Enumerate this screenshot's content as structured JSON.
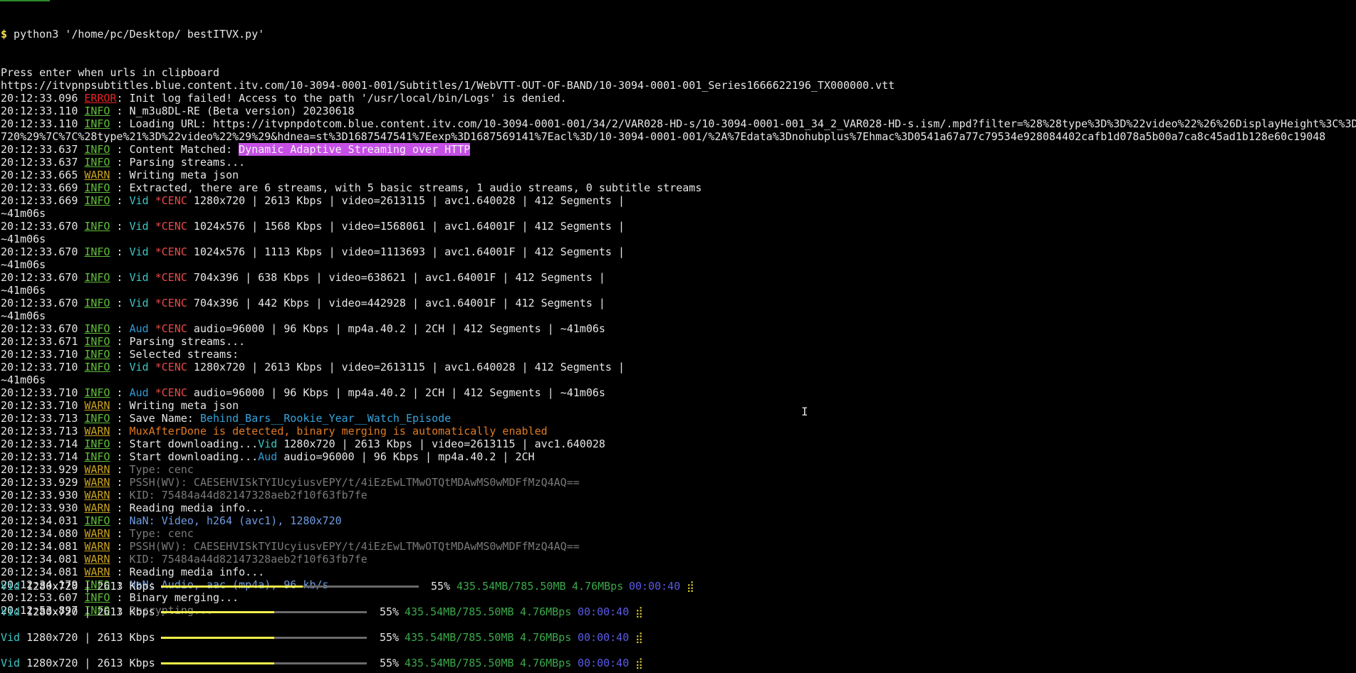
{
  "prompt": {
    "dollar": "$",
    "command": " python3 '/home/pc/Desktop/ bestITVX.py'"
  },
  "lines": [
    [
      {
        "t": "Press enter when urls in clipboard",
        "c": "plain"
      }
    ],
    [
      {
        "t": "https://itvpnpsubtitles.blue.content.itv.com/10-3094-0001-001/Subtitles/1/WebVTT-OUT-OF-BAND/10-3094-0001-001_Series1666622196_TX000000.vtt",
        "c": "plain"
      }
    ],
    [
      {
        "t": "20:12:33.096 ",
        "c": "ts"
      },
      {
        "t": "ERROR",
        "c": "error"
      },
      {
        "t": ": Init log failed! Access to the path '/usr/local/bin/Logs' is denied.",
        "c": "plain"
      }
    ],
    [
      {
        "t": "20:12:33.110 ",
        "c": "ts"
      },
      {
        "t": "INFO",
        "c": "info"
      },
      {
        "t": " : N_m3u8DL-RE (Beta version) 20230618",
        "c": "plain"
      }
    ],
    [
      {
        "t": "20:12:33.110 ",
        "c": "ts"
      },
      {
        "t": "INFO",
        "c": "info"
      },
      {
        "t": " : Loading URL: https://itvpnpdotcom.blue.content.itv.com/10-3094-0001-001/34/2/VAR028-HD-s/10-3094-0001-001_34_2_VAR028-HD-s.ism/.mpd?filter=%28%28type%3D%3D%22video%22%26%26DisplayHeight%3C%3D",
        "c": "plain"
      }
    ],
    [
      {
        "t": "720%29%7C%7C%28type%21%3D%22video%22%29%29&hdnea=st%3D1687547541%7Eexp%3D1687569141%7Eacl%3D/10-3094-0001-001/%2A%7Edata%3Dnohubplus%7Ehmac%3D0541a67a77c79534e928084402cafb1d078a5b00a7ca8c45ad1b128e60c19048",
        "c": "plain"
      }
    ],
    [
      {
        "t": "20:12:33.637 ",
        "c": "ts"
      },
      {
        "t": "INFO",
        "c": "info"
      },
      {
        "t": " : Content Matched: ",
        "c": "plain"
      },
      {
        "t": "Dynamic Adaptive Streaming over HTTP",
        "c": "highlight"
      }
    ],
    [
      {
        "t": "20:12:33.637 ",
        "c": "ts"
      },
      {
        "t": "INFO",
        "c": "info"
      },
      {
        "t": " : Parsing streams...",
        "c": "plain"
      }
    ],
    [
      {
        "t": "20:12:33.665 ",
        "c": "ts"
      },
      {
        "t": "WARN",
        "c": "warn"
      },
      {
        "t": " : Writing meta json",
        "c": "plain"
      }
    ],
    [
      {
        "t": "20:12:33.669 ",
        "c": "ts"
      },
      {
        "t": "INFO",
        "c": "info"
      },
      {
        "t": " : Extracted, there are 6 streams, with 5 basic streams, 1 audio streams, 0 subtitle streams",
        "c": "plain"
      }
    ],
    [
      {
        "t": "20:12:33.669 ",
        "c": "ts"
      },
      {
        "t": "INFO",
        "c": "info"
      },
      {
        "t": " : ",
        "c": "plain"
      },
      {
        "t": "Vid",
        "c": "vid"
      },
      {
        "t": " ",
        "c": "plain"
      },
      {
        "t": "*CENC",
        "c": "cenc"
      },
      {
        "t": " 1280x720 | 2613 Kbps | video=2613115 | avc1.640028 | 412 Segments |",
        "c": "plain"
      }
    ],
    [
      {
        "t": "~41m06s",
        "c": "plain"
      }
    ],
    [
      {
        "t": "20:12:33.670 ",
        "c": "ts"
      },
      {
        "t": "INFO",
        "c": "info"
      },
      {
        "t": " : ",
        "c": "plain"
      },
      {
        "t": "Vid",
        "c": "vid"
      },
      {
        "t": " ",
        "c": "plain"
      },
      {
        "t": "*CENC",
        "c": "cenc"
      },
      {
        "t": " 1024x576 | 1568 Kbps | video=1568061 | avc1.64001F | 412 Segments |",
        "c": "plain"
      }
    ],
    [
      {
        "t": "~41m06s",
        "c": "plain"
      }
    ],
    [
      {
        "t": "20:12:33.670 ",
        "c": "ts"
      },
      {
        "t": "INFO",
        "c": "info"
      },
      {
        "t": " : ",
        "c": "plain"
      },
      {
        "t": "Vid",
        "c": "vid"
      },
      {
        "t": " ",
        "c": "plain"
      },
      {
        "t": "*CENC",
        "c": "cenc"
      },
      {
        "t": " 1024x576 | 1113 Kbps | video=1113693 | avc1.64001F | 412 Segments |",
        "c": "plain"
      }
    ],
    [
      {
        "t": "~41m06s",
        "c": "plain"
      }
    ],
    [
      {
        "t": "20:12:33.670 ",
        "c": "ts"
      },
      {
        "t": "INFO",
        "c": "info"
      },
      {
        "t": " : ",
        "c": "plain"
      },
      {
        "t": "Vid",
        "c": "vid"
      },
      {
        "t": " ",
        "c": "plain"
      },
      {
        "t": "*CENC",
        "c": "cenc"
      },
      {
        "t": " 704x396 | 638 Kbps | video=638621 | avc1.64001F | 412 Segments |",
        "c": "plain"
      }
    ],
    [
      {
        "t": "~41m06s",
        "c": "plain"
      }
    ],
    [
      {
        "t": "20:12:33.670 ",
        "c": "ts"
      },
      {
        "t": "INFO",
        "c": "info"
      },
      {
        "t": " : ",
        "c": "plain"
      },
      {
        "t": "Vid",
        "c": "vid"
      },
      {
        "t": " ",
        "c": "plain"
      },
      {
        "t": "*CENC",
        "c": "cenc"
      },
      {
        "t": " 704x396 | 442 Kbps | video=442928 | avc1.64001F | 412 Segments |",
        "c": "plain"
      }
    ],
    [
      {
        "t": "~41m06s",
        "c": "plain"
      }
    ],
    [
      {
        "t": "20:12:33.670 ",
        "c": "ts"
      },
      {
        "t": "INFO",
        "c": "info"
      },
      {
        "t": " : ",
        "c": "plain"
      },
      {
        "t": "Aud",
        "c": "aud"
      },
      {
        "t": " ",
        "c": "plain"
      },
      {
        "t": "*CENC",
        "c": "cenc"
      },
      {
        "t": " audio=96000 | 96 Kbps | mp4a.40.2 | 2CH | 412 Segments | ~41m06s",
        "c": "plain"
      }
    ],
    [
      {
        "t": "20:12:33.671 ",
        "c": "ts"
      },
      {
        "t": "INFO",
        "c": "info"
      },
      {
        "t": " : Parsing streams...",
        "c": "plain"
      }
    ],
    [
      {
        "t": "20:12:33.710 ",
        "c": "ts"
      },
      {
        "t": "INFO",
        "c": "info"
      },
      {
        "t": " : Selected streams:",
        "c": "plain"
      }
    ],
    [
      {
        "t": "20:12:33.710 ",
        "c": "ts"
      },
      {
        "t": "INFO",
        "c": "info"
      },
      {
        "t": " : ",
        "c": "plain"
      },
      {
        "t": "Vid",
        "c": "vid"
      },
      {
        "t": " ",
        "c": "plain"
      },
      {
        "t": "*CENC",
        "c": "cenc"
      },
      {
        "t": " 1280x720 | 2613 Kbps | video=2613115 | avc1.640028 | 412 Segments |",
        "c": "plain"
      }
    ],
    [
      {
        "t": "~41m06s",
        "c": "plain"
      }
    ],
    [
      {
        "t": "20:12:33.710 ",
        "c": "ts"
      },
      {
        "t": "INFO",
        "c": "info"
      },
      {
        "t": " : ",
        "c": "plain"
      },
      {
        "t": "Aud",
        "c": "aud"
      },
      {
        "t": " ",
        "c": "plain"
      },
      {
        "t": "*CENC",
        "c": "cenc"
      },
      {
        "t": " audio=96000 | 96 Kbps | mp4a.40.2 | 2CH | 412 Segments | ~41m06s",
        "c": "plain"
      }
    ],
    [
      {
        "t": "20:12:33.710 ",
        "c": "ts"
      },
      {
        "t": "WARN",
        "c": "warn"
      },
      {
        "t": " : Writing meta json",
        "c": "plain"
      }
    ],
    [
      {
        "t": "20:12:33.713 ",
        "c": "ts"
      },
      {
        "t": "INFO",
        "c": "info"
      },
      {
        "t": " : Save Name: ",
        "c": "plain"
      },
      {
        "t": "Behind_Bars__Rookie_Year__Watch_Episode",
        "c": "savename"
      }
    ],
    [
      {
        "t": "20:12:33.713 ",
        "c": "ts"
      },
      {
        "t": "WARN",
        "c": "warn"
      },
      {
        "t": " : ",
        "c": "plain"
      },
      {
        "t": "MuxAfterDone is detected, binary merging is automatically enabled",
        "c": "orange"
      }
    ],
    [
      {
        "t": "20:12:33.714 ",
        "c": "ts"
      },
      {
        "t": "INFO",
        "c": "info"
      },
      {
        "t": " : Start downloading...",
        "c": "plain"
      },
      {
        "t": "Vid",
        "c": "vid"
      },
      {
        "t": " 1280x720 | 2613 Kbps | video=2613115 | avc1.640028",
        "c": "plain"
      }
    ],
    [
      {
        "t": "20:12:33.714 ",
        "c": "ts"
      },
      {
        "t": "INFO",
        "c": "info"
      },
      {
        "t": " : Start downloading...",
        "c": "plain"
      },
      {
        "t": "Aud",
        "c": "aud"
      },
      {
        "t": " audio=96000 | 96 Kbps | mp4a.40.2 | 2CH",
        "c": "plain"
      }
    ],
    [
      {
        "t": "20:12:33.929 ",
        "c": "ts"
      },
      {
        "t": "WARN",
        "c": "warn"
      },
      {
        "t": " : ",
        "c": "plain"
      },
      {
        "t": "Type: cenc",
        "c": "dim"
      }
    ],
    [
      {
        "t": "20:12:33.929 ",
        "c": "ts"
      },
      {
        "t": "WARN",
        "c": "warn"
      },
      {
        "t": " : ",
        "c": "plain"
      },
      {
        "t": "PSSH(WV): CAESEHVISkTYIUcyiusvEPY/t/4iEzEwLTMwOTQtMDAwMS0wMDFfMzQ4AQ==",
        "c": "dim"
      }
    ],
    [
      {
        "t": "20:12:33.930 ",
        "c": "ts"
      },
      {
        "t": "WARN",
        "c": "warn"
      },
      {
        "t": " : ",
        "c": "plain"
      },
      {
        "t": "KID: 75484a44d82147328aeb2f10f63fb7fe",
        "c": "dim"
      }
    ],
    [
      {
        "t": "20:12:33.930 ",
        "c": "ts"
      },
      {
        "t": "WARN",
        "c": "warn"
      },
      {
        "t": " : Reading media info...",
        "c": "plain"
      }
    ],
    [
      {
        "t": "20:12:34.031 ",
        "c": "ts"
      },
      {
        "t": "INFO",
        "c": "info"
      },
      {
        "t": " : ",
        "c": "plain"
      },
      {
        "t": "NaN: Video, h264 (avc1), 1280x720",
        "c": "nan"
      }
    ],
    [
      {
        "t": "20:12:34.080 ",
        "c": "ts"
      },
      {
        "t": "WARN",
        "c": "warn"
      },
      {
        "t": " : ",
        "c": "plain"
      },
      {
        "t": "Type: cenc",
        "c": "dim"
      }
    ],
    [
      {
        "t": "20:12:34.081 ",
        "c": "ts"
      },
      {
        "t": "WARN",
        "c": "warn"
      },
      {
        "t": " : ",
        "c": "plain"
      },
      {
        "t": "PSSH(WV): CAESEHVISkTYIUcyiusvEPY/t/4iEzEwLTMwOTQtMDAwMS0wMDFfMzQ4AQ==",
        "c": "dim"
      }
    ],
    [
      {
        "t": "20:12:34.081 ",
        "c": "ts"
      },
      {
        "t": "WARN",
        "c": "warn"
      },
      {
        "t": " : ",
        "c": "plain"
      },
      {
        "t": "KID: 75484a44d82147328aeb2f10f63fb7fe",
        "c": "dim"
      }
    ],
    [
      {
        "t": "20:12:34.081 ",
        "c": "ts"
      },
      {
        "t": "WARN",
        "c": "warn"
      },
      {
        "t": " : Reading media info...",
        "c": "plain"
      }
    ],
    [
      {
        "t": "20:12:34.179 ",
        "c": "ts"
      },
      {
        "t": "INFO",
        "c": "info"
      },
      {
        "t": " : ",
        "c": "plain"
      },
      {
        "t": "NaN: Audio, aac (mp4a), 96 kb/s",
        "c": "nan"
      }
    ],
    [
      {
        "t": "20:12:53.607 ",
        "c": "ts"
      },
      {
        "t": "INFO",
        "c": "info"
      },
      {
        "t": " : Binary merging...",
        "c": "plain"
      }
    ],
    [
      {
        "t": "20:12:53.897 ",
        "c": "ts"
      },
      {
        "t": "INFO",
        "c": "info"
      },
      {
        "t": " : ",
        "c": "plain"
      },
      {
        "t": "Decrypting...",
        "c": "dim"
      }
    ]
  ],
  "progress_rows": [
    {
      "kind": "Vid",
      "label": " 1280x720 | 2613 Kbps",
      "progress": 0.55,
      "percent": "55%",
      "size": "435.54MB/785.50MB",
      "speed": "4.76MBps",
      "eta": "00:00:40",
      "spinner": "⣾"
    },
    {
      "kind": "Vid",
      "label": " 1280x720 | 2613 Kbps",
      "progress": 0.55,
      "percent": "55%",
      "size": "435.54MB/785.50MB",
      "speed": "4.76MBps",
      "eta": "00:00:40",
      "spinner": "⣾"
    },
    {
      "kind": "Vid",
      "label": " 1280x720 | 2613 Kbps",
      "progress": 0.55,
      "percent": "55%",
      "size": "435.54MB/785.50MB",
      "speed": "4.76MBps",
      "eta": "00:00:40",
      "spinner": "⣾"
    },
    {
      "kind": "Vid",
      "label": " 1280x720 | 2613 Kbps",
      "progress": 0.55,
      "percent": "55%",
      "size": "435.54MB/785.50MB",
      "speed": "4.76MBps",
      "eta": "00:00:40",
      "spinner": "⣾"
    }
  ],
  "colors": {
    "background": "#000000",
    "info": "#5fbf3a",
    "warn": "#c8a21e",
    "error": "#e82424",
    "vid": "#3cc7c7",
    "aud": "#2f9ad6",
    "cenc": "#e84a4a",
    "highlight": "#c650e6",
    "progress_fill": "#f2f04a",
    "progress_track": "#6a6a6a"
  },
  "cursor_icon": "text-ibeam-cursor-icon"
}
